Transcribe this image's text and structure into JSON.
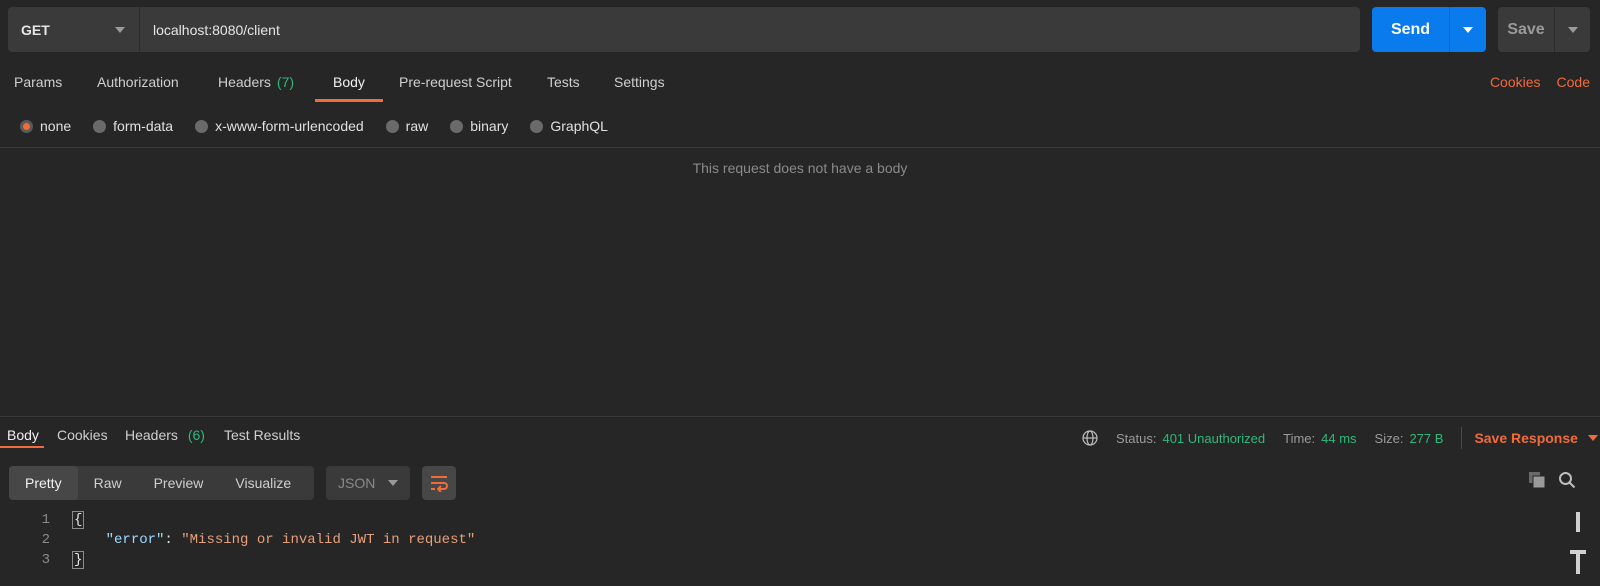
{
  "request": {
    "method": "GET",
    "url": "localhost:8080/client",
    "send_label": "Send",
    "save_label": "Save"
  },
  "request_tabs": [
    {
      "label": "Params"
    },
    {
      "label": "Authorization"
    },
    {
      "label": "Headers",
      "count": "(7)"
    },
    {
      "label": "Body",
      "active": true
    },
    {
      "label": "Pre-request Script"
    },
    {
      "label": "Tests"
    },
    {
      "label": "Settings"
    }
  ],
  "request_links": {
    "cookies": "Cookies",
    "code": "Code"
  },
  "body_types": [
    {
      "label": "none",
      "selected": true
    },
    {
      "label": "form-data"
    },
    {
      "label": "x-www-form-urlencoded"
    },
    {
      "label": "raw"
    },
    {
      "label": "binary"
    },
    {
      "label": "GraphQL"
    }
  ],
  "empty_message": "This request does not have a body",
  "response_tabs": [
    {
      "label": "Body",
      "active": true
    },
    {
      "label": "Cookies"
    },
    {
      "label": "Headers",
      "count": "(6)"
    },
    {
      "label": "Test Results"
    }
  ],
  "response_meta": {
    "status_label": "Status:",
    "status_value": "401 Unauthorized",
    "time_label": "Time:",
    "time_value": "44 ms",
    "size_label": "Size:",
    "size_value": "277 B",
    "save_response": "Save Response"
  },
  "view_modes": [
    {
      "label": "Pretty",
      "active": true
    },
    {
      "label": "Raw"
    },
    {
      "label": "Preview"
    },
    {
      "label": "Visualize"
    }
  ],
  "format": "JSON",
  "code_lines": [
    {
      "num": "1",
      "text": "{"
    },
    {
      "num": "2",
      "key": "\"error\"",
      "sep": ": ",
      "value": "\"Missing or invalid JWT in request\""
    },
    {
      "num": "3",
      "text": "}"
    }
  ],
  "colors": {
    "accent": "#f26b3a",
    "send": "#097bed",
    "success": "#2fb87b",
    "background": "#262626"
  },
  "icons": {
    "globe": "globe-icon",
    "wrap": "wrap-lines-icon",
    "copy": "copy-icon",
    "search": "search-icon"
  }
}
